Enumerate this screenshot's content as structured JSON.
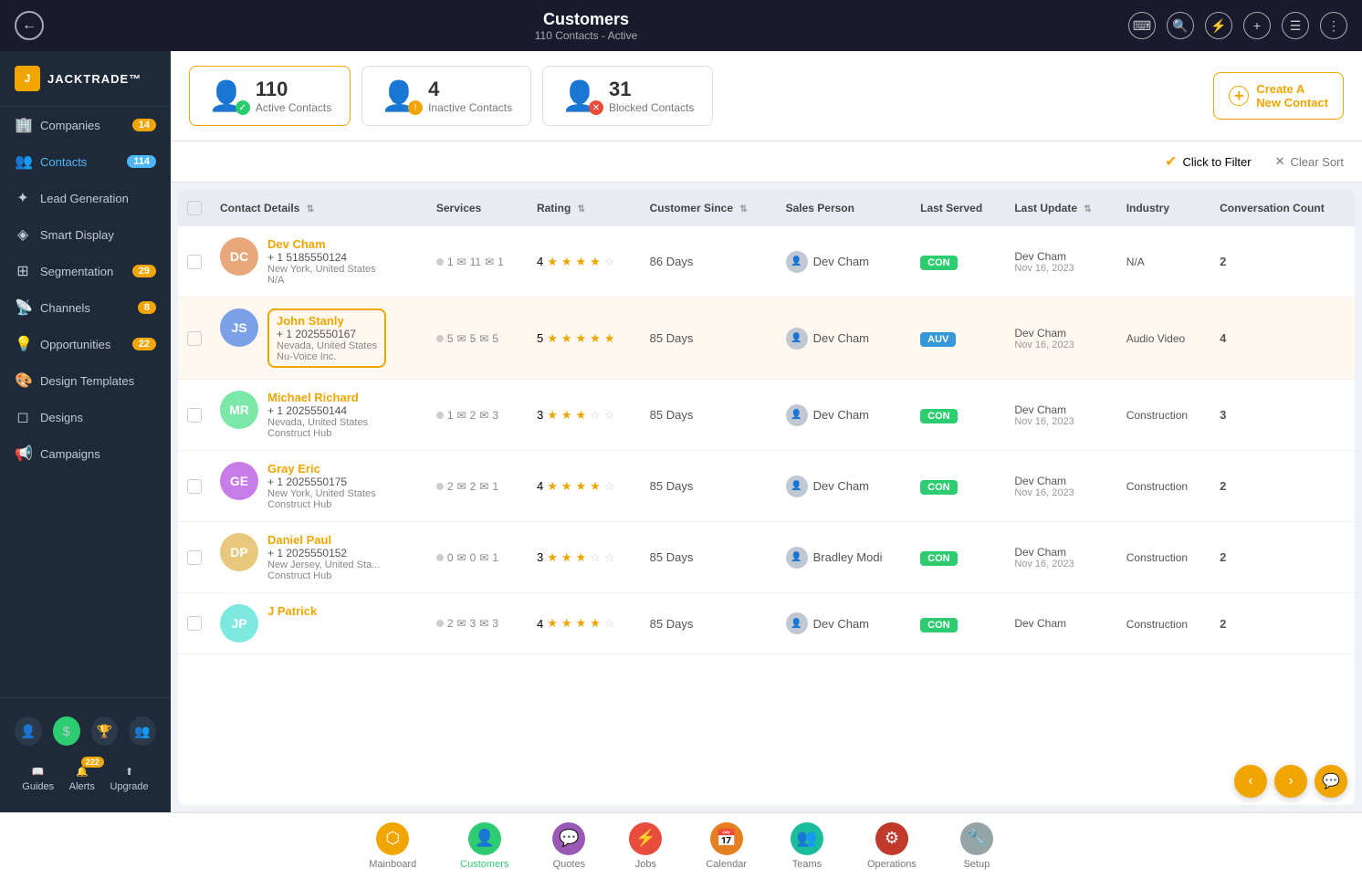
{
  "app": {
    "title": "Customers",
    "subtitle": "110 Contacts - Active"
  },
  "topbar": {
    "back_icon": "←",
    "icons": [
      "⌨",
      "🔍",
      "⚡",
      "+",
      "☰",
      "⋮"
    ]
  },
  "sidebar": {
    "logo": "JACKTRADE™",
    "items": [
      {
        "id": "companies",
        "label": "Companies",
        "badge": "14",
        "icon": "🏢"
      },
      {
        "id": "contacts",
        "label": "Contacts",
        "badge": "114",
        "icon": "👥",
        "active": true
      },
      {
        "id": "lead-generation",
        "label": "Lead Generation",
        "icon": "✦"
      },
      {
        "id": "smart-display",
        "label": "Smart Display",
        "icon": ""
      },
      {
        "id": "segmentation",
        "label": "Segmentation",
        "badge": "29",
        "icon": "⊞"
      },
      {
        "id": "channels",
        "label": "Channels",
        "badge": "8",
        "icon": "📡"
      },
      {
        "id": "opportunities",
        "label": "Opportunities",
        "badge": "22",
        "icon": "💡"
      },
      {
        "id": "design-templates",
        "label": "Design Templates",
        "icon": "🎨"
      },
      {
        "id": "designs",
        "label": "Designs",
        "icon": ""
      },
      {
        "id": "campaigns",
        "label": "Campaigns",
        "icon": "📢"
      }
    ],
    "bottom": {
      "guides_label": "Guides",
      "alerts_label": "Alerts",
      "alerts_badge": "222",
      "upgrade_label": "Upgrade"
    }
  },
  "stats": {
    "active": {
      "count": "110",
      "label": "Active Contacts",
      "badge_type": "green"
    },
    "inactive": {
      "count": "4",
      "label": "Inactive Contacts",
      "badge_type": "orange"
    },
    "blocked": {
      "count": "31",
      "label": "Blocked Contacts",
      "badge_type": "red"
    }
  },
  "create_btn": "Create A\nNew Contact",
  "filter": {
    "click_to_filter": "Click to Filter",
    "clear_sort": "Clear Sort"
  },
  "table": {
    "columns": [
      "Contact Details",
      "Services",
      "Rating",
      "Customer Since",
      "Sales Person",
      "Last Served",
      "Last Update",
      "Industry",
      "Conversation Count"
    ],
    "rows": [
      {
        "id": "dc",
        "initials": "DC",
        "avatar_color": "#e8a87c",
        "name": "Dev Cham",
        "phone": "+ 1 5185550124",
        "location": "New York, United States",
        "company": "N/A",
        "svc_dot": 1,
        "svc_msg": 11,
        "svc_call": 1,
        "rating": 4,
        "customer_since": "86 Days",
        "sales_person": "Dev Cham",
        "last_served_tag": "CON",
        "last_served_color": "#2ecc71",
        "last_update_name": "Dev Cham",
        "last_update_date": "Nov 16, 2023",
        "industry": "N/A",
        "conv_count": "2",
        "highlighted": false
      },
      {
        "id": "js",
        "initials": "JS",
        "avatar_img": true,
        "name": "John Stanly",
        "phone": "+ 1 2025550167",
        "location": "Nevada, United States",
        "company": "Nu-Voice Inc.",
        "svc_dot": 5,
        "svc_msg": 5,
        "svc_call": 5,
        "rating": 5,
        "customer_since": "85 Days",
        "sales_person": "Dev Cham",
        "last_served_tag": "AUV",
        "last_served_color": "#3498db",
        "last_update_name": "Dev Cham",
        "last_update_date": "Nov 16, 2023",
        "industry": "Audio Video",
        "conv_count": "4",
        "highlighted": true
      },
      {
        "id": "mr",
        "initials": "MR",
        "avatar_img": true,
        "name": "Michael Richard",
        "phone": "+ 1 2025550144",
        "location": "Nevada, United States",
        "company": "Construct Hub",
        "svc_dot": 1,
        "svc_msg": 2,
        "svc_call": 3,
        "rating": 3,
        "customer_since": "85 Days",
        "sales_person": "Dev Cham",
        "last_served_tag": "CON",
        "last_served_color": "#2ecc71",
        "last_update_name": "Dev Cham",
        "last_update_date": "Nov 16, 2023",
        "industry": "Construction",
        "conv_count": "3",
        "highlighted": false
      },
      {
        "id": "ge",
        "initials": "GE",
        "avatar_img": true,
        "name": "Gray Eric",
        "phone": "+ 1 2025550175",
        "location": "New York, United States",
        "company": "Construct Hub",
        "svc_dot": 2,
        "svc_msg": 2,
        "svc_call": 1,
        "rating": 4,
        "customer_since": "85 Days",
        "sales_person": "Dev Cham",
        "last_served_tag": "CON",
        "last_served_color": "#2ecc71",
        "last_update_name": "Dev Cham",
        "last_update_date": "Nov 16, 2023",
        "industry": "Construction",
        "conv_count": "2",
        "highlighted": false
      },
      {
        "id": "dp",
        "initials": "DP",
        "avatar_img": true,
        "name": "Daniel Paul",
        "phone": "+ 1 2025550152",
        "location": "New Jersey, United Sta...",
        "company": "Construct Hub",
        "svc_dot": 0,
        "svc_msg": 0,
        "svc_call": 1,
        "rating": 3,
        "customer_since": "85 Days",
        "sales_person": "Bradley Modi",
        "last_served_tag": "CON",
        "last_served_color": "#2ecc71",
        "last_update_name": "Dev Cham",
        "last_update_date": "Nov 16, 2023",
        "industry": "Construction",
        "conv_count": "2",
        "highlighted": false
      },
      {
        "id": "jp",
        "initials": "JP",
        "avatar_img": true,
        "name": "J Patrick",
        "phone": "",
        "location": "",
        "company": "",
        "svc_dot": 2,
        "svc_msg": 3,
        "svc_call": 3,
        "rating": 4,
        "customer_since": "85 Days",
        "sales_person": "Dev Cham",
        "last_served_tag": "CON",
        "last_served_color": "#2ecc71",
        "last_update_name": "Dev Cham",
        "last_update_date": "",
        "industry": "Construction",
        "conv_count": "2",
        "highlighted": false
      }
    ]
  },
  "bottom_nav": {
    "items": [
      {
        "id": "mainboard",
        "label": "Mainboard",
        "icon": "⬡",
        "color": "yellow"
      },
      {
        "id": "customers",
        "label": "Customers",
        "icon": "👤",
        "color": "green",
        "active": true
      },
      {
        "id": "quotes",
        "label": "Quotes",
        "icon": "💬",
        "color": "purple"
      },
      {
        "id": "jobs",
        "label": "Jobs",
        "icon": "⚡",
        "color": "red"
      },
      {
        "id": "calendar",
        "label": "Calendar",
        "icon": "📅",
        "color": "orange"
      },
      {
        "id": "teams",
        "label": "Teams",
        "icon": "👥",
        "color": "teal"
      },
      {
        "id": "operations",
        "label": "Operations",
        "icon": "⚙",
        "color": "dark-red"
      },
      {
        "id": "setup",
        "label": "Setup",
        "icon": "🔧",
        "color": "gray"
      }
    ]
  }
}
